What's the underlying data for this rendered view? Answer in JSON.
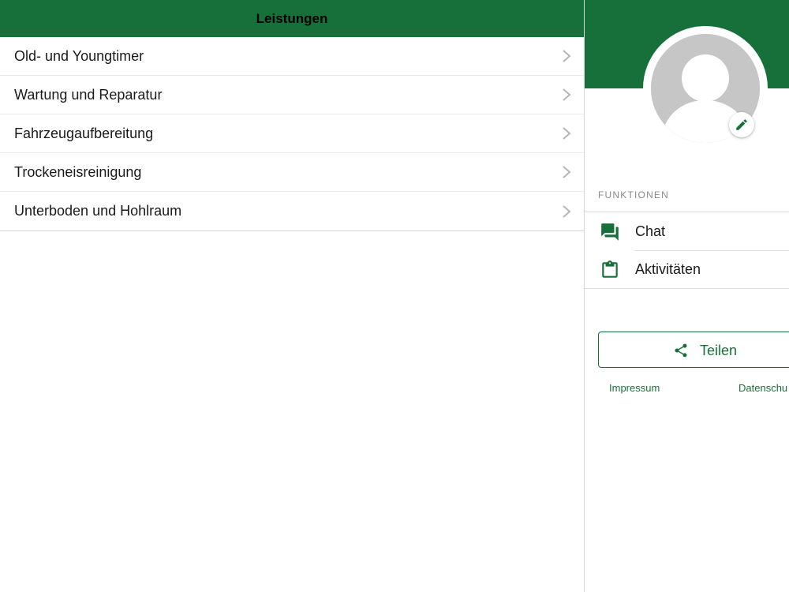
{
  "colors": {
    "brand_green": "#17703a",
    "avatar_gray": "#c6c6c6",
    "text": "#1a1a1a",
    "section_label": "#8a8a8a"
  },
  "services": {
    "title": "Leistungen",
    "items": [
      {
        "label": "Old- und Youngtimer",
        "icon": "chevron-right-icon"
      },
      {
        "label": "Wartung und Reparatur",
        "icon": "chevron-right-icon"
      },
      {
        "label": "Fahrzeugaufbereitung",
        "icon": "chevron-right-icon"
      },
      {
        "label": "Trockeneisreinigung",
        "icon": "chevron-right-icon"
      },
      {
        "label": "Unterboden und Hohlraum",
        "icon": "chevron-right-icon"
      }
    ]
  },
  "profile": {
    "avatar_icon": "default-user-avatar-icon",
    "edit_icon": "pencil-icon"
  },
  "functions": {
    "section_title": "FUNKTIONEN",
    "items": [
      {
        "label": "Chat",
        "icon": "chat-bubbles-icon"
      },
      {
        "label": "Aktivitäten",
        "icon": "clipboard-icon"
      }
    ]
  },
  "share": {
    "label": "Teilen",
    "icon": "share-icon"
  },
  "footer": {
    "impressum": "Impressum",
    "datenschutz": "Datenschu"
  }
}
